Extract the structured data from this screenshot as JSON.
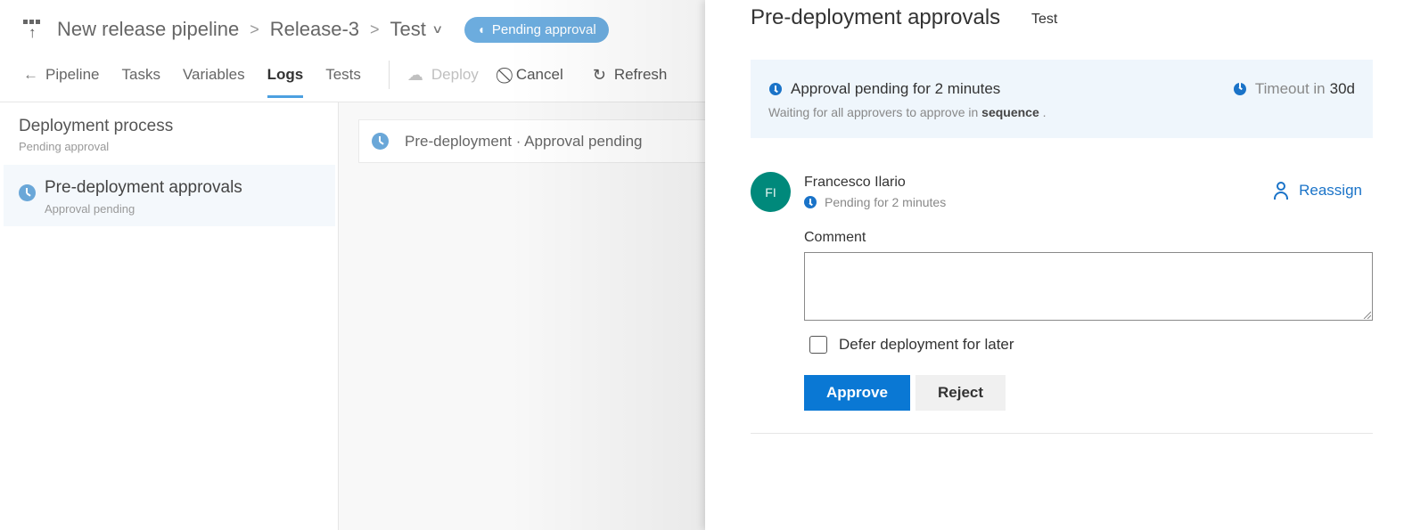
{
  "header": {
    "pipeline_name": "New release pipeline",
    "release_name": "Release-3",
    "environment": "Test",
    "status_badge": "Pending approval"
  },
  "tabs": [
    {
      "label": "Pipeline",
      "active": false
    },
    {
      "label": "Tasks",
      "active": false
    },
    {
      "label": "Variables",
      "active": false
    },
    {
      "label": "Logs",
      "active": true
    },
    {
      "label": "Tests",
      "active": false
    }
  ],
  "toolbar": {
    "deploy": "Deploy",
    "cancel": "Cancel",
    "refresh": "Refresh"
  },
  "sidebar": {
    "title": "Deployment process",
    "subtitle": "Pending approval",
    "selected_item": {
      "title": "Pre-deployment approvals",
      "subtitle": "Approval pending"
    }
  },
  "stage_card": {
    "text": "Pre-deployment  ·  Approval pending"
  },
  "panel": {
    "title": "Pre-deployment approvals",
    "environment": "Test",
    "info": {
      "title": "Approval pending for 2 minutes",
      "subtitle_prefix": "Waiting for all approvers to approve in",
      "subtitle_bold": "sequence",
      "subtitle_suffix": ".",
      "timeout_label": "Timeout in",
      "timeout_value": "30d"
    },
    "approver": {
      "initials": "FI",
      "name": "Francesco Ilario",
      "status": "Pending for 2 minutes",
      "avatar_color": "#00897b"
    },
    "reassign_label": "Reassign",
    "comment_label": "Comment",
    "comment_value": "",
    "defer_label": "Defer deployment for later",
    "defer_checked": false,
    "approve_label": "Approve",
    "reject_label": "Reject"
  },
  "colors": {
    "accent": "#0a78d4",
    "badge": "#6cacde",
    "pending_icon": "#6aa7d8",
    "info_bg": "#eff6fc"
  }
}
